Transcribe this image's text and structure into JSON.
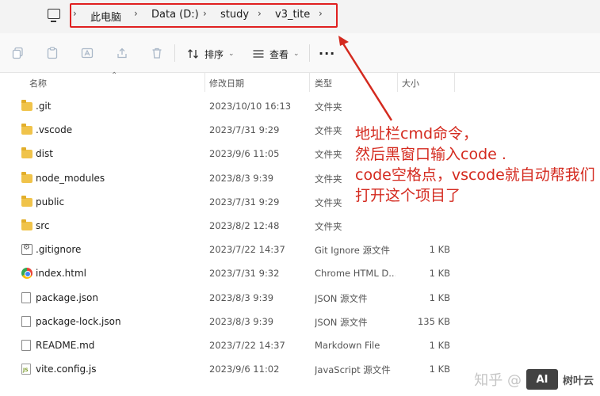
{
  "address_bar": {
    "breadcrumbs": [
      "此电脑",
      "Data (D:)",
      "study",
      "v3_tite"
    ]
  },
  "toolbar": {
    "sort_label": "排序",
    "view_label": "查看",
    "more_label": "···"
  },
  "columns": {
    "name": "名称",
    "modified": "修改日期",
    "type": "类型",
    "size": "大小"
  },
  "files": [
    {
      "icon": "folder-icon",
      "name": ".git",
      "date": "2023/10/10 16:13",
      "type": "文件夹",
      "size": ""
    },
    {
      "icon": "folder-icon",
      "name": ".vscode",
      "date": "2023/7/31 9:29",
      "type": "文件夹",
      "size": ""
    },
    {
      "icon": "folder-icon",
      "name": "dist",
      "date": "2023/9/6 11:05",
      "type": "文件夹",
      "size": ""
    },
    {
      "icon": "folder-icon",
      "name": "node_modules",
      "date": "2023/8/3 9:39",
      "type": "文件夹",
      "size": ""
    },
    {
      "icon": "folder-icon",
      "name": "public",
      "date": "2023/7/31 9:29",
      "type": "文件夹",
      "size": ""
    },
    {
      "icon": "folder-icon",
      "name": "src",
      "date": "2023/8/2 12:48",
      "type": "文件夹",
      "size": ""
    },
    {
      "icon": "gear-file-icon",
      "name": ".gitignore",
      "date": "2023/7/22 14:37",
      "type": "Git Ignore 源文件",
      "size": "1 KB"
    },
    {
      "icon": "chrome-icon",
      "name": "index.html",
      "date": "2023/7/31 9:32",
      "type": "Chrome HTML D...",
      "size": "1 KB"
    },
    {
      "icon": "document-icon",
      "name": "package.json",
      "date": "2023/8/3 9:39",
      "type": "JSON 源文件",
      "size": "1 KB"
    },
    {
      "icon": "document-icon",
      "name": "package-lock.json",
      "date": "2023/8/3 9:39",
      "type": "JSON 源文件",
      "size": "135 KB"
    },
    {
      "icon": "document-icon",
      "name": "README.md",
      "date": "2023/7/22 14:37",
      "type": "Markdown File",
      "size": "1 KB"
    },
    {
      "icon": "js-file-icon",
      "name": "vite.config.js",
      "date": "2023/9/6 11:02",
      "type": "JavaScript 源文件",
      "size": "1 KB"
    }
  ],
  "annotation": {
    "lines": [
      "地址栏cmd命令，",
      "然后黑窗口输入code .",
      "code空格点，vscode就自动帮我们",
      "打开这个项目了"
    ],
    "color": "#d42a1f"
  },
  "watermark": {
    "text": "知乎 @",
    "logo": "AI",
    "name": "树叶云"
  }
}
